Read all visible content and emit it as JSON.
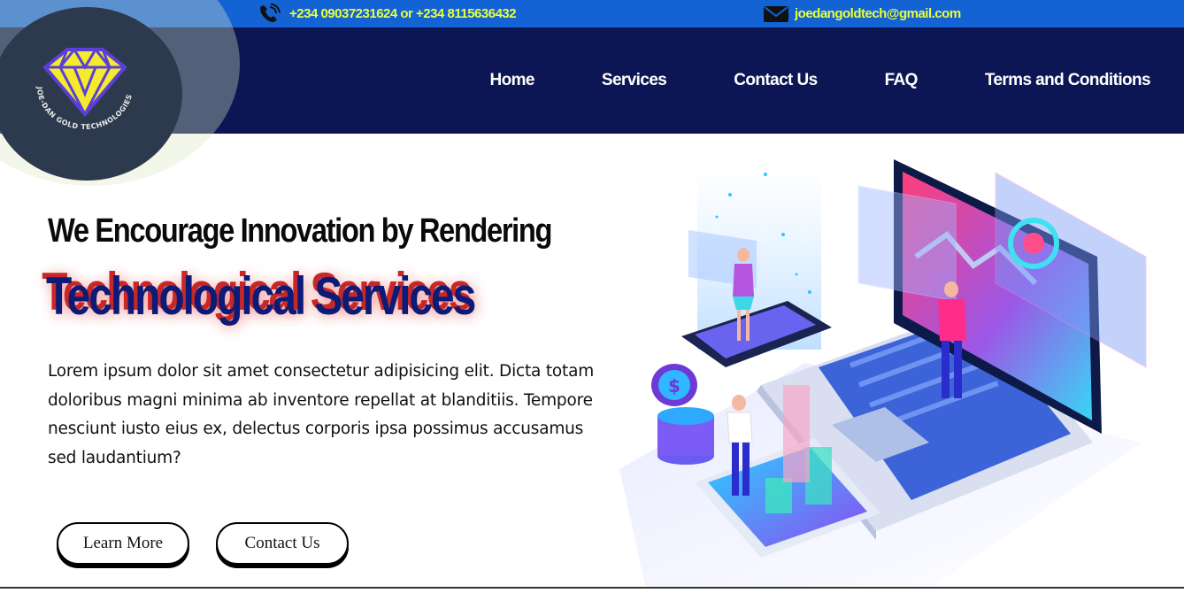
{
  "topbar": {
    "phone_icon": "phone-icon",
    "phone_text": "+234 09037231624  or +234 8115636432",
    "email_icon": "envelope-icon",
    "email_text": "joedangoldtech@gmail.com",
    "text_color": "#e9ff3a",
    "background": "#1463d4"
  },
  "navbar": {
    "background": "#0c1654",
    "logo_text": "JOE-DAN GOLD TECHNOLOGIES",
    "links": [
      {
        "label": "Home"
      },
      {
        "label": "Services"
      },
      {
        "label": "Contact Us"
      },
      {
        "label": "FAQ"
      },
      {
        "label": "Terms and Conditions"
      }
    ]
  },
  "hero": {
    "headline": "We Encourage Innovation by Rendering",
    "subheadline": "Technological Services",
    "description": "Lorem ipsum dolor sit amet consectetur adipisicing elit. Dicta totam doloribus magni minima ab inventore repellat at blanditiis. Tempore nesciunt iusto eius ex, delectus corporis ipsa possimus accusamus sed laudantium?",
    "buttons": {
      "learn_more": "Learn More",
      "contact_us": "Contact Us"
    },
    "illustration_icon": "isometric-laptop-illustration-icon",
    "accent_colors": {
      "subheadline": "#0c1a78",
      "subheadline_shadow": "#c62828"
    }
  }
}
